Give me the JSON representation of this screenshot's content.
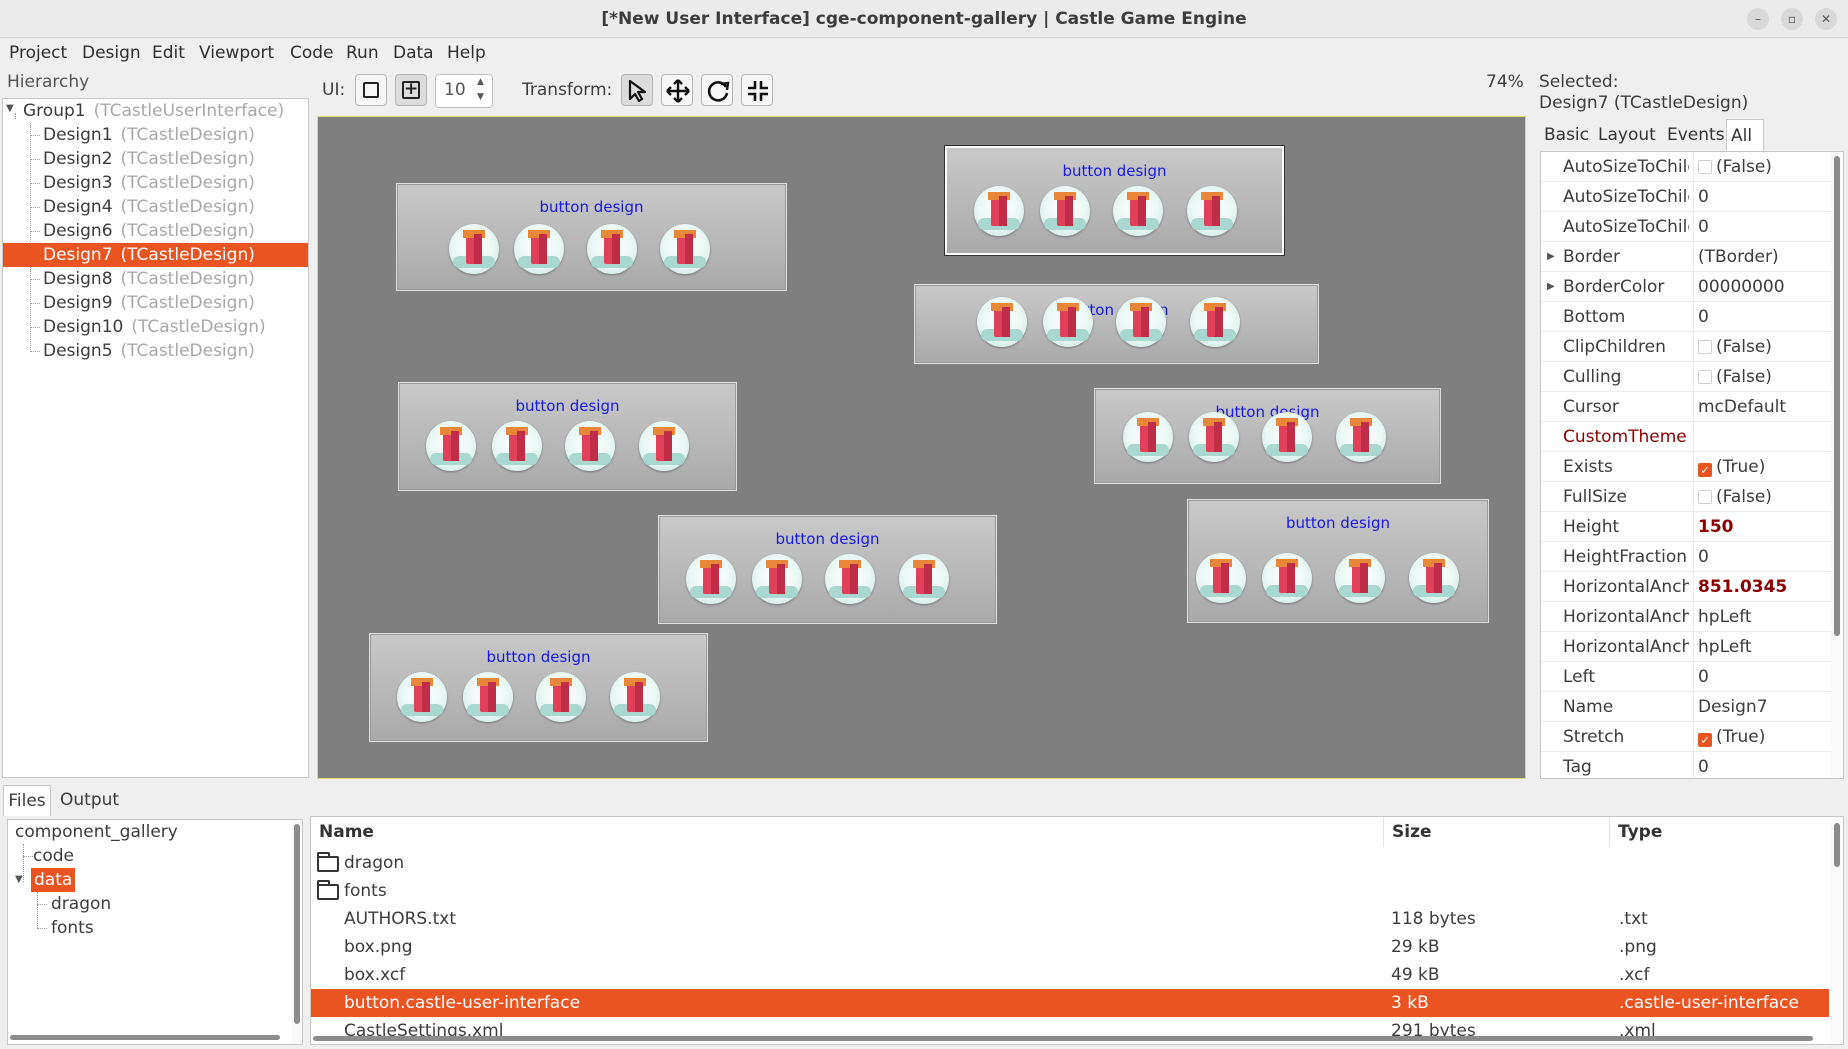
{
  "window": {
    "title": "[*New User Interface] cge-component-gallery | Castle Game Engine",
    "controls": {
      "minimize": "–",
      "restore": "▫",
      "close": "✕"
    }
  },
  "menu": [
    "Project",
    "Design",
    "Edit",
    "Viewport",
    "Code",
    "Run",
    "Data",
    "Help"
  ],
  "hierarchy": {
    "label": "Hierarchy",
    "root": {
      "name": "Group1",
      "class": "(TCastleUserInterface)"
    },
    "items": [
      {
        "name": "Design1",
        "class": "(TCastleDesign)",
        "selected": false
      },
      {
        "name": "Design2",
        "class": "(TCastleDesign)",
        "selected": false
      },
      {
        "name": "Design3",
        "class": "(TCastleDesign)",
        "selected": false
      },
      {
        "name": "Design4",
        "class": "(TCastleDesign)",
        "selected": false
      },
      {
        "name": "Design6",
        "class": "(TCastleDesign)",
        "selected": false
      },
      {
        "name": "Design7",
        "class": "(TCastleDesign)",
        "selected": true
      },
      {
        "name": "Design8",
        "class": "(TCastleDesign)",
        "selected": false
      },
      {
        "name": "Design9",
        "class": "(TCastleDesign)",
        "selected": false
      },
      {
        "name": "Design10",
        "class": "(TCastleDesign)",
        "selected": false
      },
      {
        "name": "Design5",
        "class": "(TCastleDesign)",
        "selected": false
      }
    ]
  },
  "toolbar": {
    "ui_label": "UI:",
    "snap_value": "10",
    "transform_label": "Transform:",
    "zoom": "74%"
  },
  "viewport": {
    "button_caption": "button design",
    "partial_caption_left": "tton",
    "partial_caption_right": "n",
    "partial_caption_fragment": "button design"
  },
  "selection": {
    "label": "Selected:",
    "value": "Design7 (TCastleDesign)"
  },
  "inspector": {
    "tabs": [
      "Basic",
      "Layout",
      "Events",
      "All"
    ],
    "active_tab": "All",
    "rows": [
      {
        "name": "AutoSizeToChildren",
        "value": "(False)",
        "checkbox": "off"
      },
      {
        "name": "AutoSizeToChildrenPaddingBottom",
        "value": "0"
      },
      {
        "name": "AutoSizeToChildrenPaddingRight",
        "value": "0"
      },
      {
        "name": "Border",
        "value": "(TBorder)",
        "expand": true
      },
      {
        "name": "BorderColor",
        "value": "00000000",
        "expand": true
      },
      {
        "name": "Bottom",
        "value": "0"
      },
      {
        "name": "ClipChildren",
        "value": "(False)",
        "checkbox": "off"
      },
      {
        "name": "Culling",
        "value": "(False)",
        "checkbox": "off"
      },
      {
        "name": "Cursor",
        "value": "mcDefault"
      },
      {
        "name": "CustomTheme",
        "value": "",
        "custom": true
      },
      {
        "name": "Exists",
        "value": "(True)",
        "checkbox": "on"
      },
      {
        "name": "FullSize",
        "value": "(False)",
        "checkbox": "off"
      },
      {
        "name": "Height",
        "value": "150",
        "bold": true
      },
      {
        "name": "HeightFraction",
        "value": "0"
      },
      {
        "name": "HorizontalAnchorDelta",
        "value": "851.0345",
        "bold": true
      },
      {
        "name": "HorizontalAnchorParent",
        "value": "hpLeft"
      },
      {
        "name": "HorizontalAnchorSelf",
        "value": "hpLeft"
      },
      {
        "name": "Left",
        "value": "0"
      },
      {
        "name": "Name",
        "value": "Design7"
      },
      {
        "name": "Stretch",
        "value": "(True)",
        "checkbox": "on"
      },
      {
        "name": "Tag",
        "value": "0"
      }
    ]
  },
  "bottom_tabs": [
    "Files",
    "Output"
  ],
  "files_tree": {
    "root": "component_gallery",
    "items": [
      {
        "name": "code",
        "level": 1,
        "selected": false
      },
      {
        "name": "data",
        "level": 1,
        "selected": true
      },
      {
        "name": "dragon",
        "level": 2,
        "selected": false
      },
      {
        "name": "fonts",
        "level": 2,
        "selected": false
      }
    ]
  },
  "files_list": {
    "columns": [
      "Name",
      "Size",
      "Type"
    ],
    "rows": [
      {
        "name": "dragon",
        "size": "",
        "type": "",
        "folder": true,
        "selected": false
      },
      {
        "name": "fonts",
        "size": "",
        "type": "",
        "folder": true,
        "selected": false
      },
      {
        "name": "AUTHORS.txt",
        "size": "118 bytes",
        "type": ".txt",
        "folder": false,
        "selected": false
      },
      {
        "name": "box.png",
        "size": "29 kB",
        "type": ".png",
        "folder": false,
        "selected": false
      },
      {
        "name": "box.xcf",
        "size": "49 kB",
        "type": ".xcf",
        "folder": false,
        "selected": false
      },
      {
        "name": "button.castle-user-interface",
        "size": "3 kB",
        "type": ".castle-user-interface",
        "folder": false,
        "selected": true
      },
      {
        "name": "CastleSettings.xml",
        "size": "291 bytes",
        "type": ".xml",
        "folder": false,
        "selected": false
      }
    ]
  },
  "colors": {
    "accent": "#e95420",
    "viewport_bg": "#7f7f7f",
    "caption": "#1818e0",
    "modified_value": "#8b0000"
  }
}
